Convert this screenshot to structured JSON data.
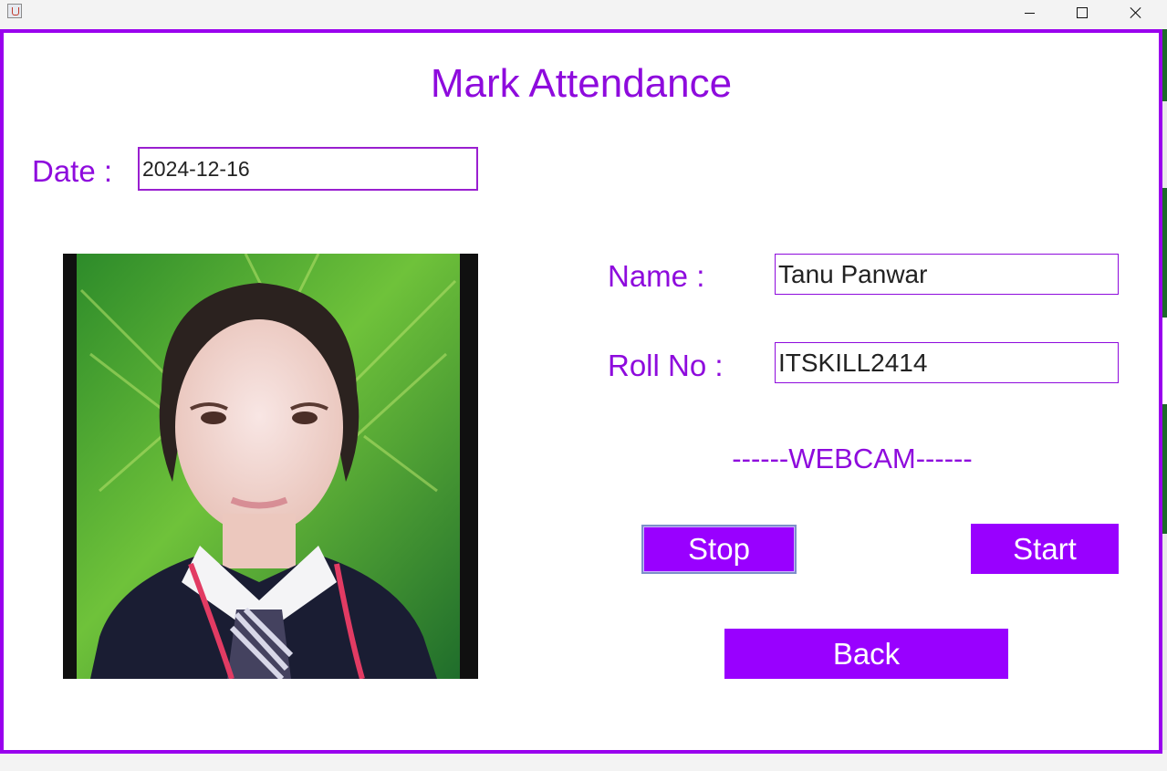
{
  "window": {
    "icon": "java-app-icon",
    "controls": [
      "minimize-icon",
      "maximize-icon",
      "close-icon"
    ]
  },
  "form": {
    "title": "Mark Attendance",
    "date_label": "Date :",
    "date_value": "2024-12-16",
    "name_label": "Name :",
    "name_value": "Tanu Panwar",
    "roll_label": "Roll No :",
    "roll_value": "ITSKILL2414",
    "webcam_label": "------WEBCAM------"
  },
  "buttons": {
    "stop": "Stop",
    "start": "Start",
    "back": "Back"
  },
  "colors": {
    "accent": "#9900ff",
    "text_accent": "#8e0bdd",
    "border": "#9900ee"
  }
}
